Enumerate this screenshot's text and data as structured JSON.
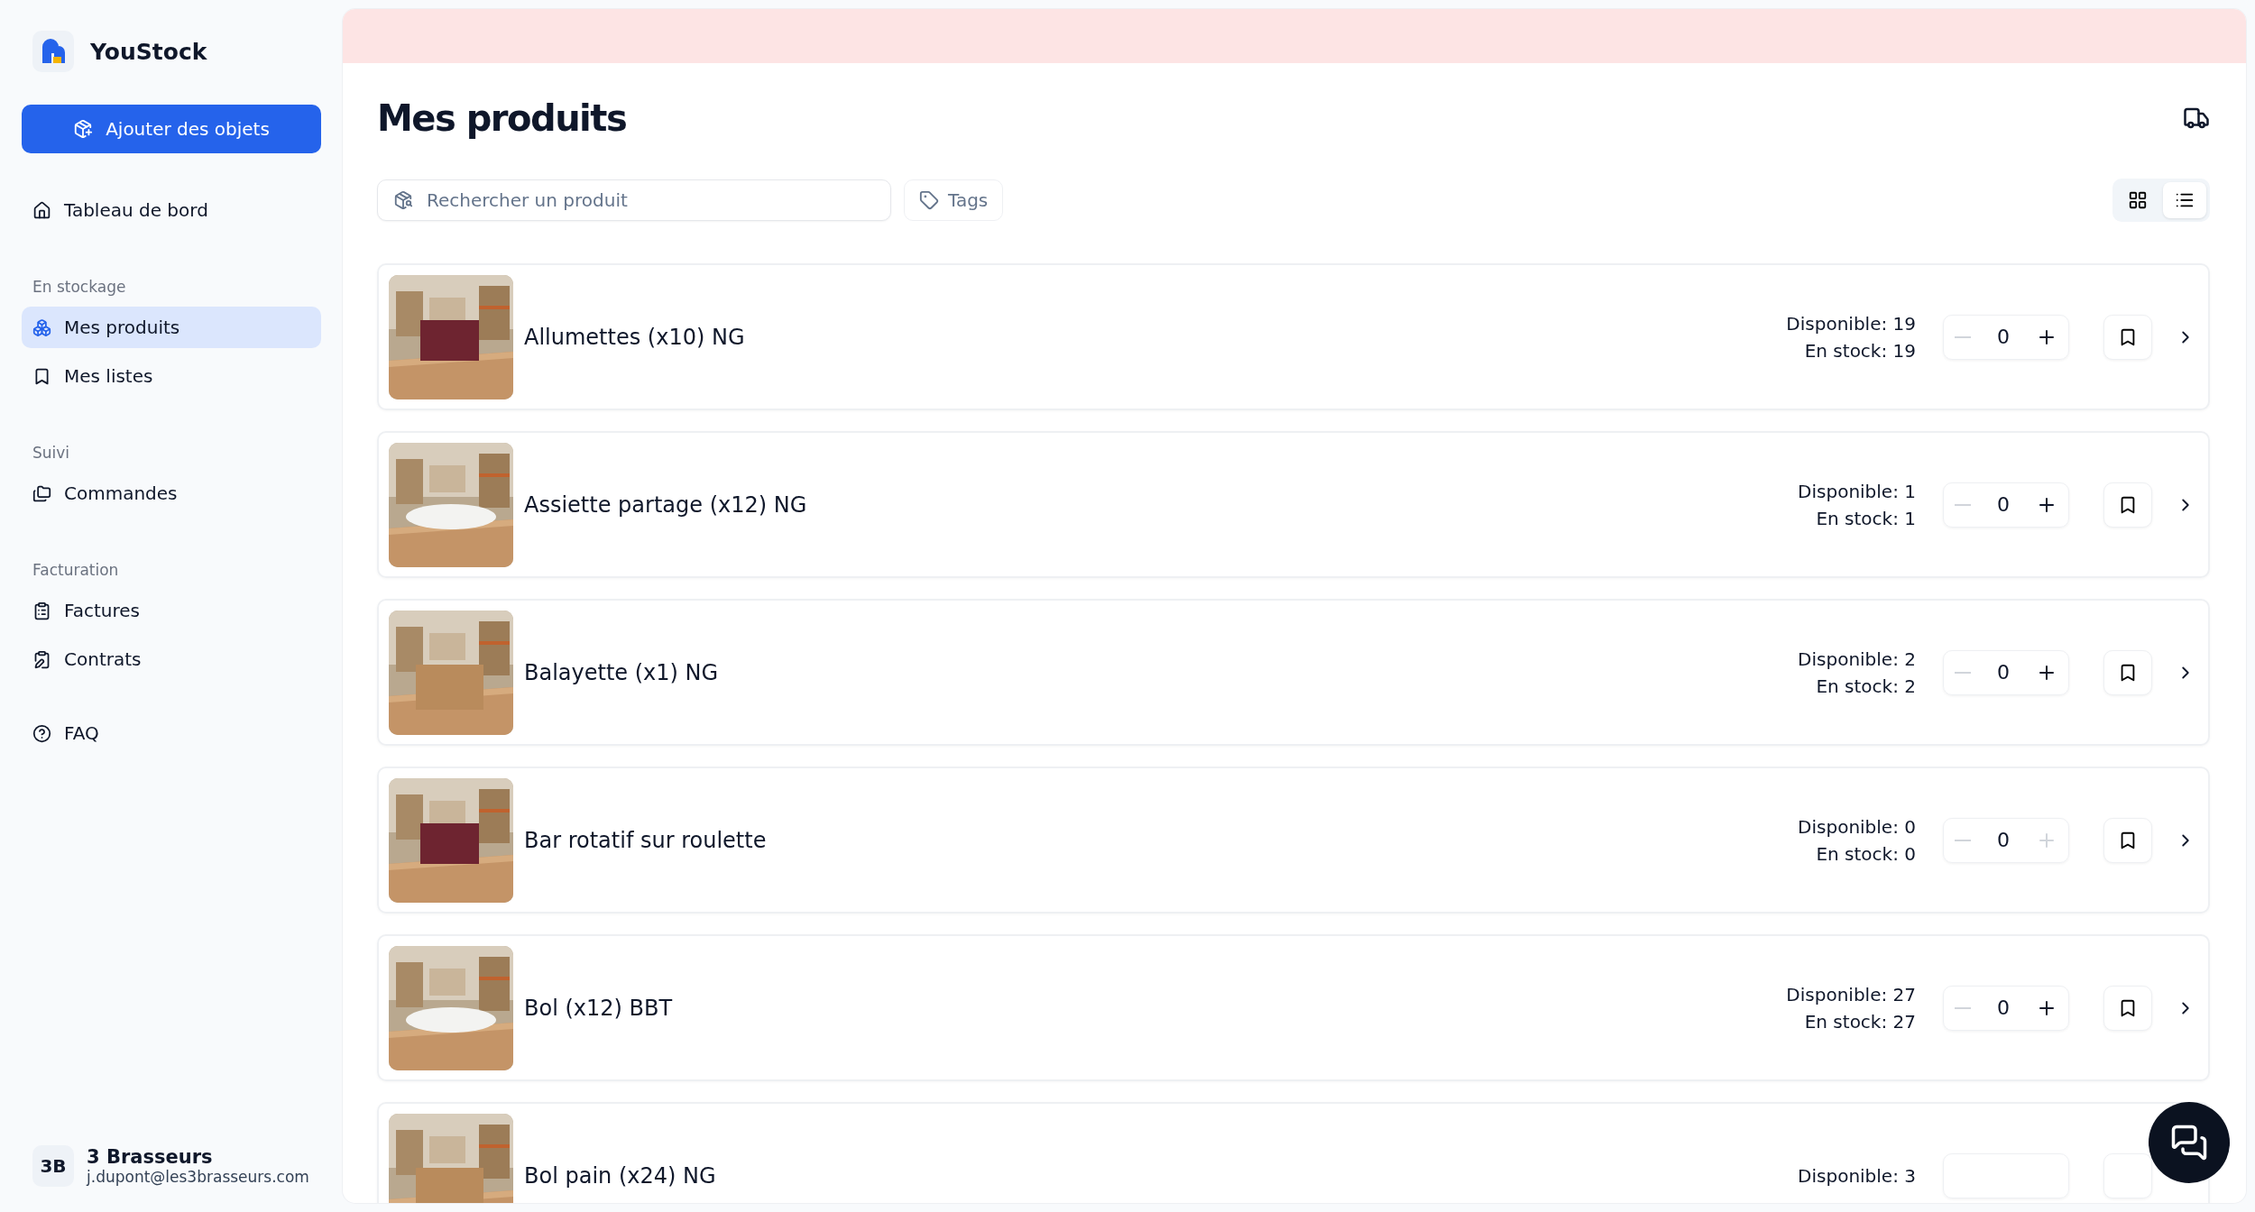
{
  "brand": {
    "name": "YouStock"
  },
  "add_button": {
    "label": "Ajouter des objets"
  },
  "sidebar": {
    "sections": [
      {
        "items": [
          {
            "label": "Tableau de bord",
            "selected": false
          }
        ]
      },
      {
        "heading": "En stockage",
        "items": [
          {
            "label": "Mes produits",
            "selected": true
          },
          {
            "label": "Mes listes",
            "selected": false
          }
        ]
      },
      {
        "heading": "Suivi",
        "items": [
          {
            "label": "Commandes",
            "selected": false
          }
        ]
      },
      {
        "heading": "Facturation",
        "items": [
          {
            "label": "Factures",
            "selected": false
          },
          {
            "label": "Contrats",
            "selected": false
          }
        ]
      },
      {
        "items": [
          {
            "label": "FAQ",
            "selected": false
          }
        ]
      }
    ]
  },
  "account": {
    "initials": "3B",
    "name": "3 Brasseurs",
    "email": "j.dupont@les3brasseurs.com"
  },
  "page": {
    "title": "Mes produits"
  },
  "search": {
    "placeholder": "Rechercher un produit"
  },
  "tags_button": {
    "label": "Tags"
  },
  "view_toggle": [
    {
      "kind": "grid",
      "selected": false
    },
    {
      "kind": "list",
      "selected": true
    }
  ],
  "products": [
    {
      "name": "Allumettes (x10) NG",
      "available": "Disponible: 19",
      "in_stock": "En stock: 19",
      "quantity": "0",
      "minus_disabled": true,
      "plus_disabled": false
    },
    {
      "name": "Assiette partage (x12) NG",
      "available": "Disponible: 1",
      "in_stock": "En stock: 1",
      "quantity": "0",
      "minus_disabled": true,
      "plus_disabled": false
    },
    {
      "name": "Balayette (x1) NG",
      "available": "Disponible: 2",
      "in_stock": "En stock: 2",
      "quantity": "0",
      "minus_disabled": true,
      "plus_disabled": false
    },
    {
      "name": "Bar rotatif sur roulette",
      "available": "Disponible: 0",
      "in_stock": "En stock: 0",
      "quantity": "0",
      "minus_disabled": true,
      "plus_disabled": true
    },
    {
      "name": "Bol (x12) BBT",
      "available": "Disponible: 27",
      "in_stock": "En stock: 27",
      "quantity": "0",
      "minus_disabled": true,
      "plus_disabled": false
    },
    {
      "name": "Bol pain (x24) NG",
      "available": "Disponible: 3"
    }
  ]
}
